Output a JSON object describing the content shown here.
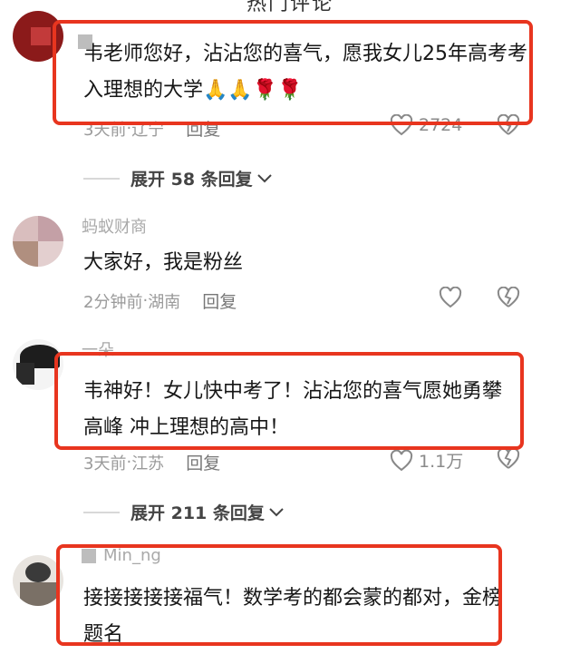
{
  "header_fragment": "热门评论",
  "comments": [
    {
      "username": "",
      "text": "韦老师您好，沾沾您的喜气，愿我女儿25年高考考入理想的大学🙏🙏🌹🌹",
      "time": "3天前",
      "location": "辽宁",
      "reply_label": "回复",
      "likes": "2724",
      "avatar_color": "#8b1a1a",
      "highlighted": true
    },
    {
      "username": "蚂蚁财商",
      "text": "大家好，我是粉丝",
      "time": "2分钟前",
      "location": "湖南",
      "reply_label": "回复",
      "likes": "",
      "avatar_color": "#c9a7a7",
      "highlighted": false
    },
    {
      "username": "一朵",
      "text": "韦神好！女儿快中考了！沾沾您的喜气愿她勇攀高峰 冲上理想的高中！",
      "time": "3天前",
      "location": "江苏",
      "reply_label": "回复",
      "likes": "1.1万",
      "avatar_color": "#222222",
      "highlighted": true
    },
    {
      "username": "Min_ng",
      "text": "接接接接接福气！数学考的都会蒙的都对，金榜题名",
      "time": "",
      "location": "",
      "reply_label": "",
      "likes": "",
      "avatar_color": "#6d6d6d",
      "highlighted": true
    }
  ],
  "expanders": [
    {
      "label": "展开 58 条回复"
    },
    {
      "label": "展开 211 条回复"
    }
  ],
  "icons": {
    "like": "heart-outline-icon",
    "dislike": "broken-heart-icon",
    "chevron": "chevron-down-icon"
  },
  "colors": {
    "highlight_border": "#e8351f",
    "meta_text": "#9a9a9a"
  }
}
